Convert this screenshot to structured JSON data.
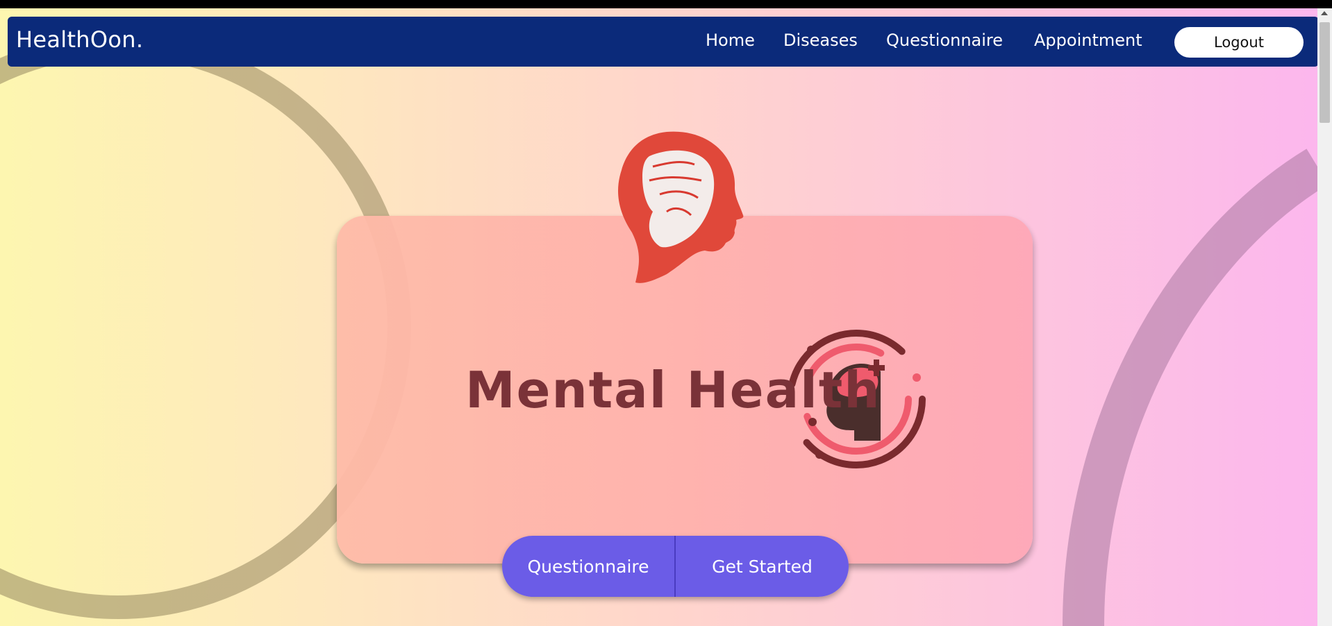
{
  "brand": "HealthOon.",
  "nav": {
    "links": [
      "Home",
      "Diseases",
      "Questionnaire",
      "Appointment"
    ],
    "logout": "Logout"
  },
  "hero": {
    "title": "Mental Health",
    "buttons": [
      "Questionnaire",
      "Get Started"
    ]
  },
  "icons": [
    "fist-brain-head-icon",
    "mental-health-head-icon"
  ],
  "colors": {
    "navbar": "#0b2a7a",
    "button": "#6b5ce7",
    "title": "#7a3238",
    "accent_red": "#e0483a"
  }
}
